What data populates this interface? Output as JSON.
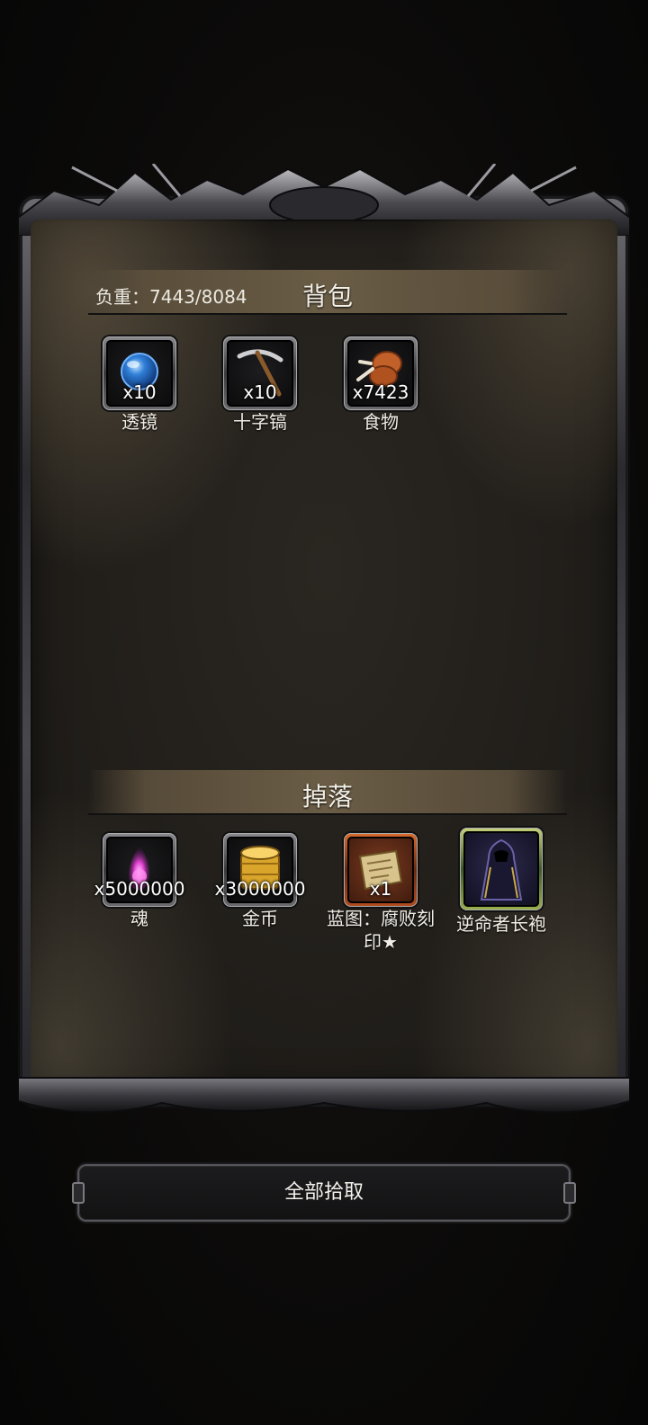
{
  "inventory": {
    "title": "背包",
    "weight_label": "负重：7443/8084",
    "items": [
      {
        "name": "透镜",
        "count": "x10",
        "icon": "lens-orb-icon"
      },
      {
        "name": "十字镐",
        "count": "x10",
        "icon": "pickaxe-icon"
      },
      {
        "name": "食物",
        "count": "x7423",
        "icon": "meat-drumstick-icon"
      }
    ]
  },
  "drops": {
    "title": "掉落",
    "items": [
      {
        "name": "魂",
        "count": "x5000000",
        "icon": "soul-flame-icon"
      },
      {
        "name": "金币",
        "count": "x3000000",
        "icon": "gold-coins-icon"
      },
      {
        "name": "蓝图：腐败刻印★",
        "count": "x1",
        "icon": "blueprint-scroll-icon"
      },
      {
        "name": "逆命者长袍",
        "count": "",
        "icon": "dark-robe-icon"
      }
    ]
  },
  "actions": {
    "pickup_all_label": "全部拾取"
  },
  "colors": {
    "frame_metal": "#5a5a5e",
    "panel_bg": "#221f1b",
    "header_band": "#6e6048",
    "rare_border": "#c85a22",
    "epic_border": "#a9bd55"
  }
}
